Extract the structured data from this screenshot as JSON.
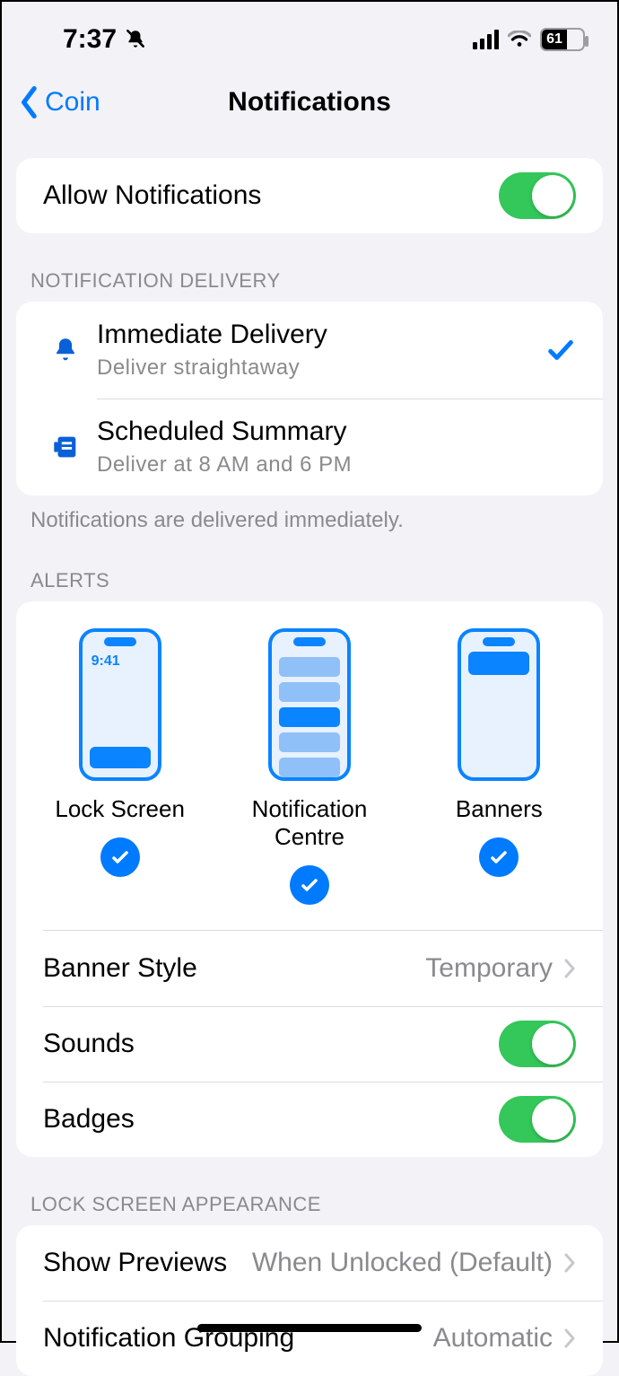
{
  "status": {
    "time": "7:37",
    "battery_pct": "61"
  },
  "nav": {
    "back_label": "Coin",
    "title": "Notifications"
  },
  "allow": {
    "label": "Allow Notifications",
    "on": true
  },
  "delivery": {
    "header": "NOTIFICATION DELIVERY",
    "items": [
      {
        "title": "Immediate Delivery",
        "sub": "Deliver straightaway",
        "selected": true
      },
      {
        "title": "Scheduled Summary",
        "sub": "Deliver at 8 AM and 6 PM",
        "selected": false
      }
    ],
    "footer": "Notifications are delivered immediately."
  },
  "alerts": {
    "header": "ALERTS",
    "lock_time": "9:41",
    "cols": [
      {
        "label": "Lock Screen",
        "checked": true
      },
      {
        "label": "Notification Centre",
        "checked": true
      },
      {
        "label": "Banners",
        "checked": true
      }
    ],
    "banner_style": {
      "label": "Banner Style",
      "value": "Temporary"
    },
    "sounds": {
      "label": "Sounds",
      "on": true
    },
    "badges": {
      "label": "Badges",
      "on": true
    }
  },
  "lockscreen": {
    "header": "LOCK SCREEN APPEARANCE",
    "show_previews": {
      "label": "Show Previews",
      "value": "When Unlocked (Default)"
    },
    "grouping": {
      "label": "Notification Grouping",
      "value": "Automatic"
    }
  }
}
